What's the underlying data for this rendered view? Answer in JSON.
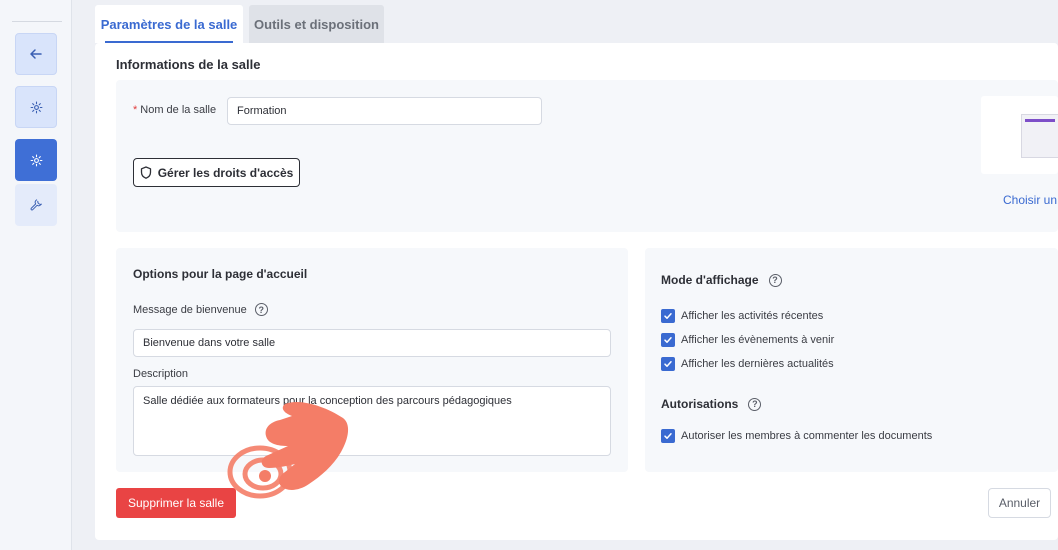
{
  "tabs": [
    {
      "label": "Paramètres de la salle",
      "active": true
    },
    {
      "label": "Outils et disposition",
      "active": false
    }
  ],
  "info": {
    "title": "Informations de la salle",
    "name_label": "Nom de la salle",
    "required_mark": "*",
    "name_value": "Formation",
    "access_button": "Gérer les droits d'accès",
    "choose_link": "Choisir un"
  },
  "options": {
    "title": "Options pour la page d'accueil",
    "welcome_label": "Message de bienvenue",
    "welcome_value": "Bienvenue dans votre salle",
    "description_label": "Description",
    "description_value": "Salle dédiée aux formateurs pour la conception des parcours pédagogiques"
  },
  "display_mode": {
    "title": "Mode d'affichage",
    "checkboxes": [
      {
        "label": "Afficher les activités récentes",
        "checked": true
      },
      {
        "label": "Afficher les évènements à venir",
        "checked": true
      },
      {
        "label": "Afficher les dernières actualités",
        "checked": true
      }
    ]
  },
  "authorizations": {
    "title": "Autorisations",
    "checkboxes": [
      {
        "label": "Autoriser les membres à commenter les documents",
        "checked": true
      }
    ]
  },
  "actions": {
    "delete": "Supprimer la salle",
    "cancel": "Annuler"
  },
  "help_glyph": "?",
  "colors": {
    "accent": "#3a6ad1",
    "danger": "#e94444",
    "pointer": "#f47d67"
  },
  "icons": [
    "arrow-left-icon",
    "gear-icon",
    "wrench-icon",
    "shield-icon",
    "help-circle-icon",
    "checkmark-icon",
    "hand-pointer-icon"
  ]
}
